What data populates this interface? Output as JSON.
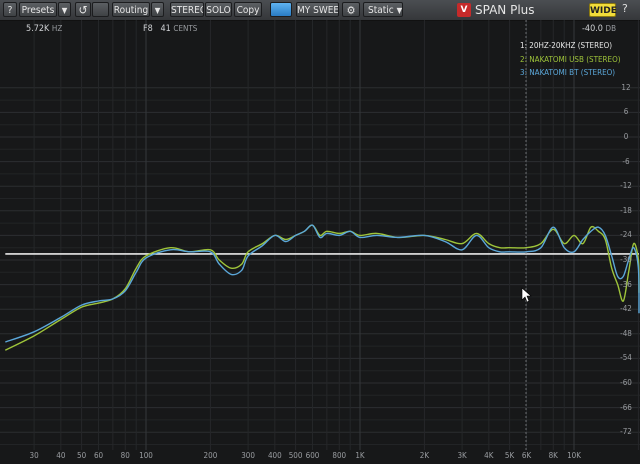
{
  "toolbar": {
    "help": "?",
    "presets": "Presets",
    "undo": "↺",
    "routing": "Routing",
    "stereo": "STEREO",
    "solo": "SOLO",
    "copy": "Copy",
    "sweep": "MY SWEEP",
    "mode": "Static",
    "dropdown": "▼",
    "gear": "⚙",
    "logo": "V",
    "product": "SPAN Plus",
    "wide": "WIDE"
  },
  "readouts": {
    "freq_value": "5.72K",
    "freq_unit": "HZ",
    "note": "F8",
    "cents_value": "41",
    "cents_unit": "CENTS",
    "level_value": "-40.0",
    "level_unit": "DB"
  },
  "legend": [
    {
      "label": "1: 20HZ-20KHZ (STEREO)",
      "color": "#e8e8e8"
    },
    {
      "label": "2: NAKATOMI USB (STEREO)",
      "color": "#9ec43a"
    },
    {
      "label": "3: NAKATOMI BT (STEREO)",
      "color": "#5ba7d9"
    }
  ],
  "db_labels": [
    "12",
    "6",
    "0",
    "-6",
    "-12",
    "-18",
    "-24",
    "-30",
    "-36",
    "-42",
    "-48",
    "-54",
    "-60",
    "-66",
    "-72"
  ],
  "freq_labels": [
    "30",
    "40",
    "50",
    "60",
    "80",
    "100",
    "200",
    "300",
    "400",
    "500",
    "600",
    "800",
    "1K",
    "2K",
    "3K",
    "4K",
    "5K",
    "6K",
    "8K",
    "10K"
  ],
  "chart_data": {
    "type": "line",
    "xscale": "log",
    "xlim": [
      22,
      22000
    ],
    "ylim": [
      -75,
      18
    ],
    "series": [
      {
        "name": "1: 20HZ-20KHZ (STEREO)",
        "color": "#e8e8e8",
        "points": [
          [
            22,
            -28.5
          ],
          [
            22000,
            -28.5
          ]
        ]
      },
      {
        "name": "2: NAKATOMI USB (STEREO)",
        "color": "#9ec43a",
        "points": [
          [
            22,
            -52
          ],
          [
            30,
            -48.5
          ],
          [
            40,
            -44.5
          ],
          [
            50,
            -41.5
          ],
          [
            60,
            -40.5
          ],
          [
            70,
            -39.5
          ],
          [
            80,
            -37
          ],
          [
            90,
            -32
          ],
          [
            100,
            -29
          ],
          [
            130,
            -27
          ],
          [
            160,
            -28
          ],
          [
            200,
            -27.5
          ],
          [
            220,
            -30
          ],
          [
            250,
            -32
          ],
          [
            280,
            -31
          ],
          [
            300,
            -28
          ],
          [
            350,
            -26
          ],
          [
            400,
            -24
          ],
          [
            450,
            -25
          ],
          [
            500,
            -24
          ],
          [
            550,
            -23
          ],
          [
            600,
            -21.5
          ],
          [
            650,
            -24
          ],
          [
            700,
            -23
          ],
          [
            800,
            -23.5
          ],
          [
            900,
            -23
          ],
          [
            1000,
            -24
          ],
          [
            1200,
            -23.5
          ],
          [
            1500,
            -24.5
          ],
          [
            2000,
            -24
          ],
          [
            2500,
            -25
          ],
          [
            3000,
            -26
          ],
          [
            3500,
            -23.5
          ],
          [
            4000,
            -26
          ],
          [
            4500,
            -27
          ],
          [
            5000,
            -27
          ],
          [
            6000,
            -27
          ],
          [
            7000,
            -26
          ],
          [
            8000,
            -22.5
          ],
          [
            9000,
            -26
          ],
          [
            10000,
            -24
          ],
          [
            11000,
            -26
          ],
          [
            12000,
            -22
          ],
          [
            13000,
            -23
          ],
          [
            14000,
            -25
          ],
          [
            15000,
            -32
          ],
          [
            16000,
            -36
          ],
          [
            17000,
            -40
          ],
          [
            18000,
            -33
          ],
          [
            19000,
            -26
          ],
          [
            20000,
            -30
          ],
          [
            22000,
            -38
          ]
        ]
      },
      {
        "name": "3: NAKATOMI BT (STEREO)",
        "color": "#5ba7d9",
        "points": [
          [
            22,
            -50
          ],
          [
            30,
            -47.5
          ],
          [
            40,
            -44
          ],
          [
            50,
            -41
          ],
          [
            60,
            -40
          ],
          [
            70,
            -39.5
          ],
          [
            80,
            -37.5
          ],
          [
            90,
            -33
          ],
          [
            100,
            -29.5
          ],
          [
            130,
            -27.5
          ],
          [
            160,
            -28
          ],
          [
            200,
            -28
          ],
          [
            220,
            -31
          ],
          [
            250,
            -33.5
          ],
          [
            280,
            -32.5
          ],
          [
            300,
            -29
          ],
          [
            350,
            -26.5
          ],
          [
            400,
            -24
          ],
          [
            450,
            -25.5
          ],
          [
            500,
            -24
          ],
          [
            550,
            -23
          ],
          [
            600,
            -21.5
          ],
          [
            650,
            -24.5
          ],
          [
            700,
            -23.5
          ],
          [
            800,
            -24
          ],
          [
            900,
            -23
          ],
          [
            1000,
            -24.5
          ],
          [
            1200,
            -24
          ],
          [
            1500,
            -24.5
          ],
          [
            2000,
            -24
          ],
          [
            2500,
            -25.5
          ],
          [
            3000,
            -27.5
          ],
          [
            3500,
            -24
          ],
          [
            4000,
            -27
          ],
          [
            4500,
            -28
          ],
          [
            5000,
            -28
          ],
          [
            6000,
            -28
          ],
          [
            7000,
            -27
          ],
          [
            8000,
            -22
          ],
          [
            9000,
            -27
          ],
          [
            10000,
            -28
          ],
          [
            11000,
            -25
          ],
          [
            12000,
            -23
          ],
          [
            13000,
            -22
          ],
          [
            14000,
            -24
          ],
          [
            15000,
            -29
          ],
          [
            16000,
            -34
          ],
          [
            17000,
            -34
          ],
          [
            18000,
            -30
          ],
          [
            19000,
            -27
          ],
          [
            20000,
            -32
          ],
          [
            22000,
            -43
          ]
        ]
      }
    ]
  }
}
